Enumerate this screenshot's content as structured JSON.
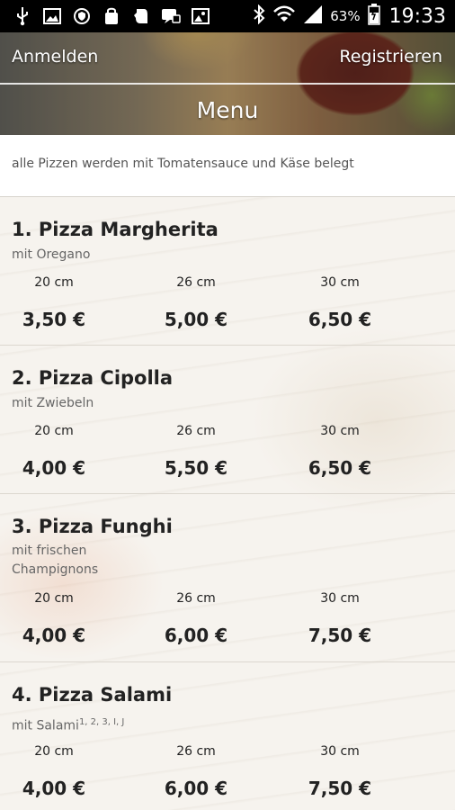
{
  "status_bar": {
    "icons": [
      "usb-icon",
      "image-icon",
      "shield-icon",
      "shopping-bag-icon",
      "evernote-icon",
      "chat-icon",
      "photo-icon",
      "bluetooth-icon",
      "wifi-icon",
      "signal-icon",
      "battery-icon"
    ],
    "battery_percent": "63%",
    "time": "19:33"
  },
  "header": {
    "login_label": "Anmelden",
    "register_label": "Registrieren",
    "title": "Menu"
  },
  "notice": "alle Pizzen werden mit Tomatensauce und Käse belegt",
  "items": [
    {
      "title": "1. Pizza Margherita",
      "desc": "mit Oregano",
      "sup": "",
      "sizes": [
        "20 cm",
        "26 cm",
        "30 cm"
      ],
      "prices": [
        "3,50 €",
        "5,00 €",
        "6,50 €"
      ]
    },
    {
      "title": "2. Pizza Cipolla",
      "desc": "mit Zwiebeln",
      "sup": "",
      "sizes": [
        "20 cm",
        "26 cm",
        "30 cm"
      ],
      "prices": [
        "4,00 €",
        "5,50 €",
        "6,50 €"
      ]
    },
    {
      "title": "3. Pizza Funghi",
      "desc": "mit frischen Champignons",
      "sup": "",
      "sizes": [
        "20 cm",
        "26 cm",
        "30 cm"
      ],
      "prices": [
        "4,00 €",
        "6,00 €",
        "7,50 €"
      ]
    },
    {
      "title": "4. Pizza Salami",
      "desc": "mit Salami",
      "sup": "1, 2, 3, I, J",
      "sizes": [
        "20 cm",
        "26 cm",
        "30 cm"
      ],
      "prices": [
        "4,00 €",
        "6,00 €",
        "7,50 €"
      ]
    }
  ]
}
